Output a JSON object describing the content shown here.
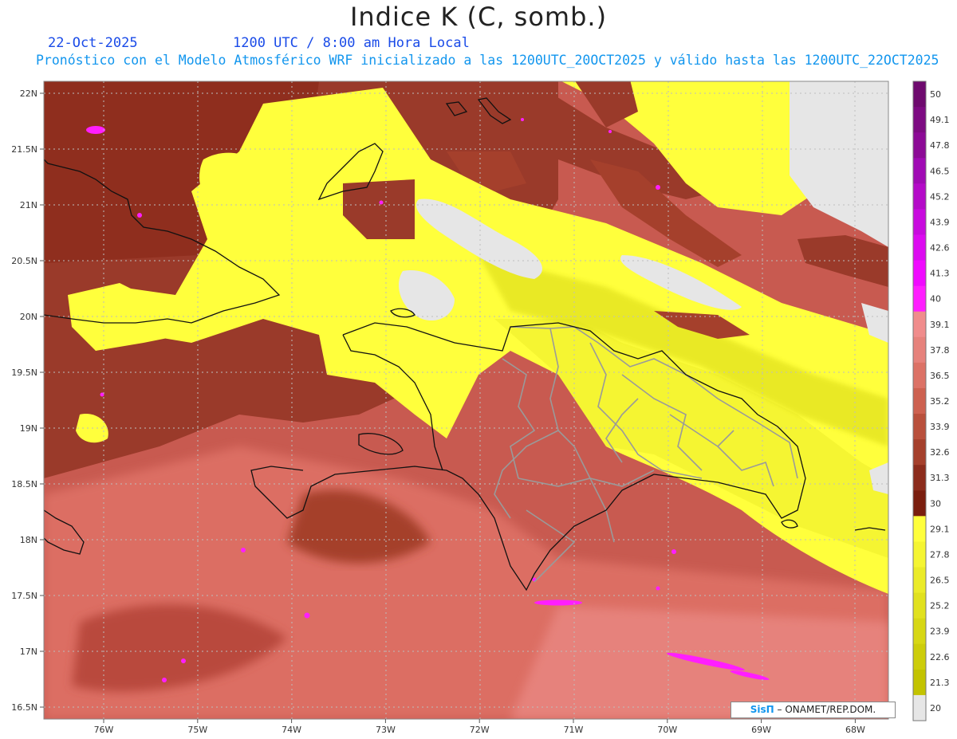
{
  "header": {
    "title": "Indice K (C, somb.)",
    "date": "22-Oct-2025",
    "time": "1200 UTC / 8:00 am Hora Local",
    "description": "Pronóstico con el Modelo Atmosférico WRF inicializado a las 1200UTC_20OCT2025 y válido hasta las  1200UTC_22OCT2025"
  },
  "map": {
    "lat_labels": [
      "22N",
      "21.5N",
      "21N",
      "20.5N",
      "20N",
      "19.5N",
      "19N",
      "18.5N",
      "18N",
      "17.5N",
      "17N",
      "16.5N"
    ],
    "lon_labels": [
      "76W",
      "75W",
      "74W",
      "73W",
      "72W",
      "71W",
      "70W",
      "69W",
      "68W"
    ]
  },
  "colorbar": {
    "levels": [
      "50",
      "49.1",
      "47.8",
      "46.5",
      "45.2",
      "43.9",
      "42.6",
      "41.3",
      "40",
      "39.1",
      "37.8",
      "36.5",
      "35.2",
      "33.9",
      "32.6",
      "31.3",
      "30",
      "29.1",
      "27.8",
      "26.5",
      "25.2",
      "23.9",
      "22.6",
      "21.3",
      "20"
    ],
    "colors": [
      "#6e0a6e",
      "#7d0b82",
      "#8c0a96",
      "#a00ab4",
      "#b40ac8",
      "#c80ade",
      "#dc0af0",
      "#f00aff",
      "#ff1eff",
      "#f08c8c",
      "#e6827c",
      "#dc7266",
      "#cd6150",
      "#b9503c",
      "#a5402c",
      "#8c2c1c",
      "#7a1e0e",
      "#ffff3c",
      "#f5f532",
      "#ebeb28",
      "#e1e11e",
      "#d7d714",
      "#cdcd0a",
      "#c3c300",
      "#e6e6e6"
    ]
  },
  "credit": {
    "brand": "SisΠ",
    "text": " – ONAMET/REP.DOM."
  }
}
